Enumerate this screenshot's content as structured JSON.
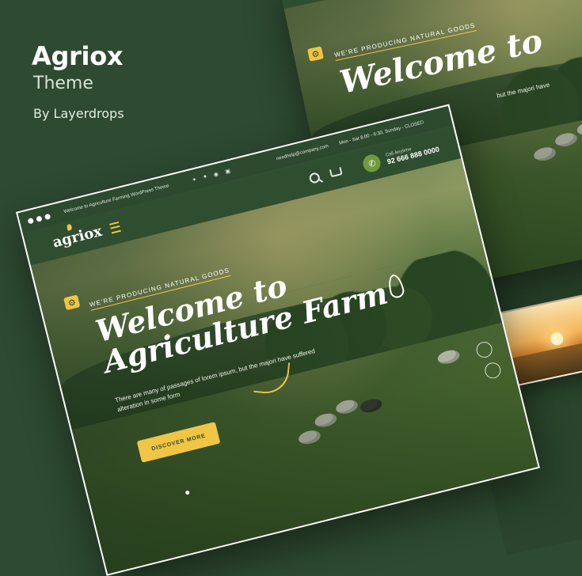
{
  "hero": {
    "title": "Agriox",
    "subtitle": "Theme",
    "author": "By Layerdrops"
  },
  "site": {
    "topbar": {
      "welcome": "Welcome to Agriculture Farming WordPress Theme",
      "social_icons": [
        "twitter-icon",
        "facebook-icon",
        "pinterest-icon",
        "instagram-icon"
      ],
      "email": "needhelp@company.com",
      "hours": "Mon - Sat 8:00 - 6:30, Sunday - CLOSED"
    },
    "logo": "agriox",
    "call_label": "Call Anytime",
    "phone": "92 666 888 0000",
    "tagline": "WE'RE PRODUCING NATURAL GOODS",
    "headline_line1": "Welcome to",
    "headline_line2": "Agriculture Farm",
    "description": "There are many of passages of lorem ipsum, but the majori have suffered alteration in some form",
    "cta": "DISCOVER MORE",
    "description_fragment": "but the majori have"
  },
  "colors": {
    "background": "#2e4a31",
    "accent": "#f0c545",
    "header": "#2d4a2f"
  }
}
